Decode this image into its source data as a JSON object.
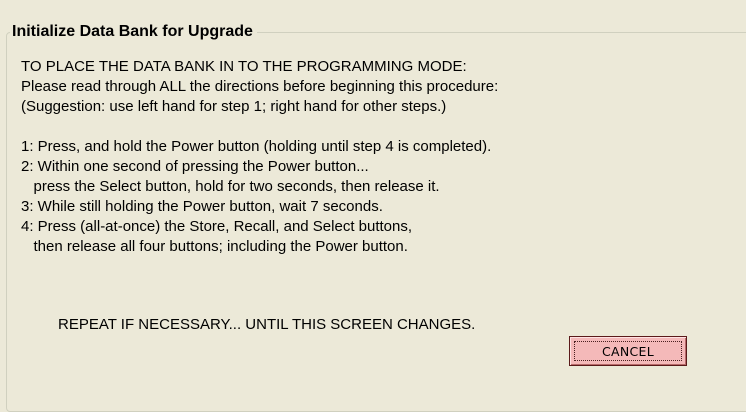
{
  "group": {
    "title": "Initialize Data Bank for Upgrade"
  },
  "instructions": {
    "intro": [
      "TO PLACE THE DATA BANK IN TO THE PROGRAMMING MODE:",
      "Please read through ALL the directions before beginning this procedure:",
      "(Suggestion: use left hand for step 1; right hand for other steps.)"
    ],
    "steps": [
      "1: Press, and hold the Power button (holding until step 4 is completed).",
      "2: Within one second of pressing the Power button...",
      "   press the Select button, hold for two seconds, then release it.",
      "3: While still holding the Power button, wait 7 seconds.",
      "4: Press (all-at-once) the Store, Recall, and Select buttons,",
      "   then release all four buttons; including the Power button."
    ],
    "repeat": "REPEAT IF NECESSARY... UNTIL THIS SCREEN CHANGES."
  },
  "buttons": {
    "cancel_label": "CANCEL"
  },
  "colors": {
    "background": "#ECE9D8",
    "cancel_button": "#F4B9B9"
  }
}
